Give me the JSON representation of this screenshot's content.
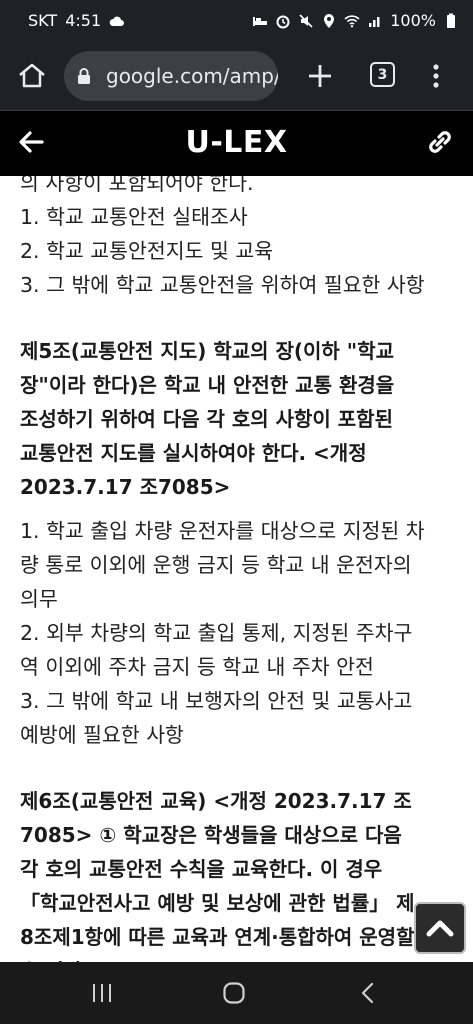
{
  "status": {
    "carrier": "SKT",
    "time": "4:51",
    "battery": "100%"
  },
  "browser": {
    "url": "google.com/amp/",
    "tab_count": "3"
  },
  "header": {
    "title": "U-LEX"
  },
  "document": {
    "intro_tail": "의 사항이 포함되어야 한다.",
    "intro_items": [
      "1. 학교 교통안전 실태조사",
      "2. 학교 교통안전지도 및 교육",
      "3. 그 밖에 학교 교통안전을 위하여 필요한 사항"
    ],
    "article5_lines": [
      "제5조(교통안전 지도) 학교의 장(이하 \"학교",
      "장\"이라 한다)은 학교 내 안전한 교통 환경을",
      "조성하기 위하여 다음 각 호의 사항이 포함된",
      "교통안전 지도를 실시하여야 한다. <개정",
      "2023.7.17 조7085>"
    ],
    "article5_items": [
      "1. 학교 출입 차량 운전자를 대상으로 지정된 차",
      "량 통로 이외에 운행 금지 등 학교 내 운전자의",
      "의무",
      "2. 외부 차량의 학교 출입 통제, 지정된 주차구",
      "역 이외에 주차 금지 등 학교 내 주차 안전",
      "3. 그 밖에 학교 내 보행자의 안전 및 교통사고",
      "예방에 필요한 사항"
    ],
    "article6_lines": [
      "제6조(교통안전 교육) <개정 2023.7.17 조",
      "7085> ① 학교장은 학생들을 대상으로 다음",
      "각 호의 교통안전 수칙을 교육한다. 이 경우",
      "「학교안전사고 예방 및 보상에 관한 법률」 제",
      "8조제1항에 따른 교육과 연계·통합하여 운영할",
      "수 있다."
    ]
  }
}
